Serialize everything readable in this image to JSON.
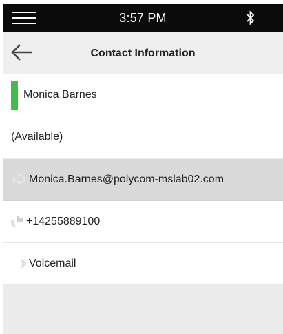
{
  "status_bar": {
    "time": "3:57 PM",
    "menu_icon": "hamburger-menu-icon",
    "bluetooth_icon": "bluetooth-icon"
  },
  "header": {
    "title": "Contact Information",
    "back_icon": "back-arrow-icon"
  },
  "contact": {
    "name": "Monica Barnes",
    "presence_color": "#3fbf4a",
    "status": "(Available)",
    "email": "Monica.Barnes@polycom-mslab02.com",
    "email_icon": "lync-call-icon",
    "phone": "+14255889100",
    "phone_icon": "work-phone-call-icon",
    "voicemail": "Voicemail",
    "voicemail_icon": "voicemail-icon"
  },
  "colors": {
    "status_bar_bg": "#0b0b0b",
    "header_bg": "#efefef",
    "selected_row_bg": "#dadada",
    "icon_gray": "#c8c8c8"
  }
}
